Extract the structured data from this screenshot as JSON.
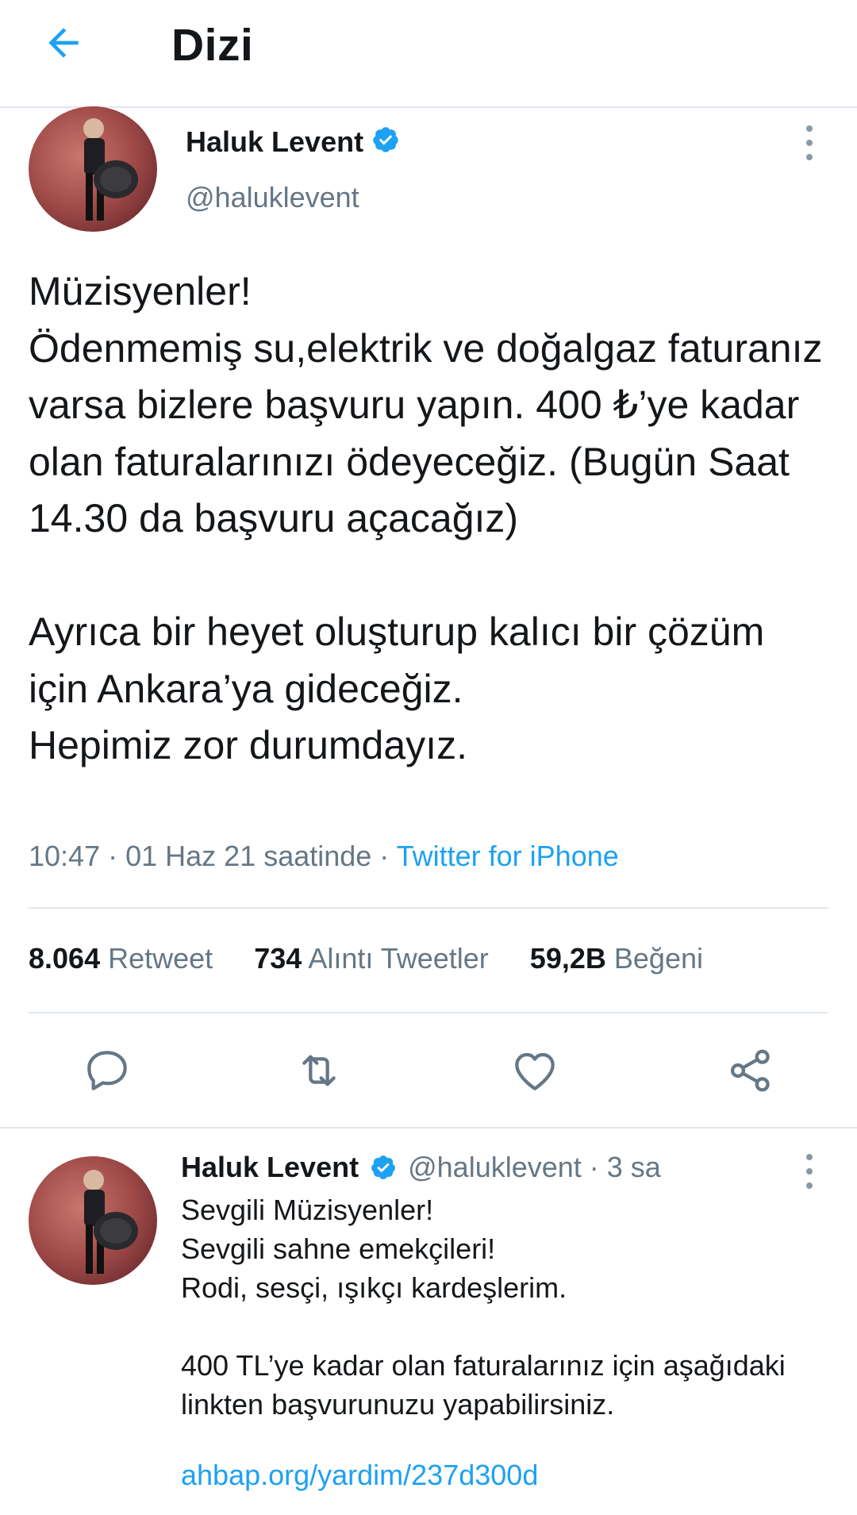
{
  "header": {
    "title": "Dizi",
    "back_icon": "arrow-left-icon",
    "accent": "#1da1f2"
  },
  "tweet": {
    "author_name": "Haluk Levent",
    "handle": "@haluklevent",
    "verified": true,
    "text": "Müzisyenler!\nÖdenmemiş su,elektrik ve doğalgaz faturanız varsa bizlere başvuru yapın. 400 ₺’ye kadar olan faturalarınızı ödeyeceğiz. (Bugün Saat 14.30 da başvuru açacağız)\n\nAyrıca bir heyet oluşturup kalıcı bir çözüm için Ankara’ya gideceğiz.\nHepimiz zor durumdayız.",
    "time": "10:47 · 01 Haz 21 saatinde · ",
    "source": "Twitter for iPhone",
    "stats": {
      "retweets": "8.064",
      "retweets_label": "Retweet",
      "quotes": "734",
      "quotes_label": "Alıntı Tweetler",
      "likes": "59,2B",
      "likes_label": "Beğeni"
    },
    "actions": [
      "reply-icon",
      "retweet-icon",
      "like-icon",
      "share-icon"
    ]
  },
  "reply": {
    "author_name": "Haluk Levent",
    "handle": "@haluklevent",
    "time": " · 3 sa",
    "text": "Sevgili Müzisyenler!\nSevgili sahne emekçileri!\nRodi, sesçi, ışıkçı kardeşlerim.\n\n400 TL’ye kadar olan faturalarınız için aşağıdaki linkten başvurunuzu yapabilirsiniz.",
    "link": "ahbap.org/yardim/237d300d"
  }
}
